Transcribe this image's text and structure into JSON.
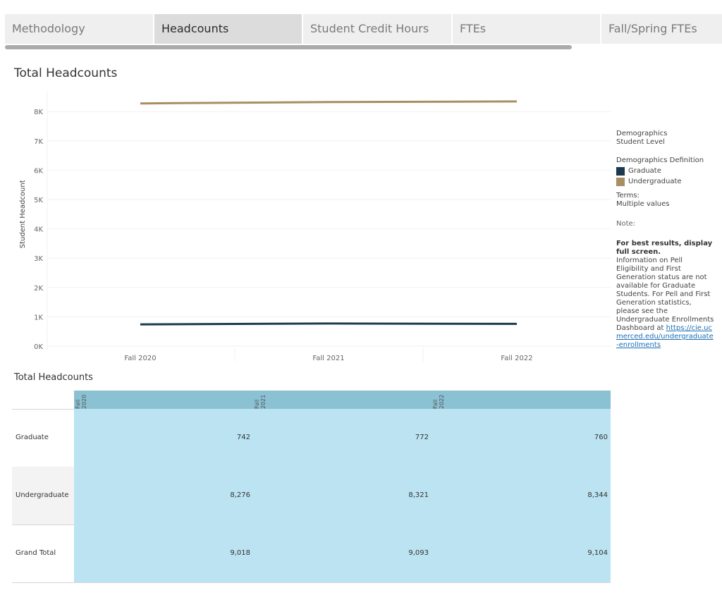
{
  "tabs": [
    {
      "label": "Methodology",
      "active": false
    },
    {
      "label": "Headcounts",
      "active": true
    },
    {
      "label": "Student Credit Hours",
      "active": false
    },
    {
      "label": "FTEs",
      "active": false
    },
    {
      "label": "Fall/Spring FTEs",
      "active": false
    }
  ],
  "chart_title": "Total Headcounts",
  "chart_data": {
    "type": "line",
    "title": "Total Headcounts",
    "xlabel": "",
    "ylabel": "Student Headcount",
    "categories": [
      "Fall 2020",
      "Fall 2021",
      "Fall 2022"
    ],
    "ylim": [
      0,
      8500
    ],
    "yticks": [
      0,
      1000,
      2000,
      3000,
      4000,
      5000,
      6000,
      7000,
      8000
    ],
    "ytick_labels": [
      "0K",
      "1K",
      "2K",
      "3K",
      "4K",
      "5K",
      "6K",
      "7K",
      "8K"
    ],
    "grid": true,
    "legend_position": "right",
    "series": [
      {
        "name": "Graduate",
        "color": "#1c3a4f",
        "values": [
          742,
          772,
          760
        ]
      },
      {
        "name": "Undergraduate",
        "color": "#a88e63",
        "values": [
          8276,
          8321,
          8344
        ]
      }
    ]
  },
  "legend": {
    "demographics_title": "Demographics",
    "demographics_value": "Student Level",
    "definition_title": "Demographics Definition",
    "items": [
      {
        "label": "Graduate",
        "color": "#1c3a4f"
      },
      {
        "label": "Undergraduate",
        "color": "#a88e63"
      }
    ],
    "terms_title": "Terms:",
    "terms_value": "Multiple values",
    "note_label": "Note:",
    "note_bold": "For best results, display full screen.",
    "note_text": "Information on Pell Eligibility and First Generation status are not available for Graduate Students. For Pell and First Generation statistics, please see the Undergraduate Enrollments Dashboard at ",
    "note_link": "https://cie.ucmerced.edu/undergraduate-enrollments"
  },
  "table": {
    "title": "Total Headcounts",
    "columns": [
      "Fall 2020",
      "Fall 2021",
      "Fall 2022"
    ],
    "rows": [
      {
        "label": "Graduate",
        "values": [
          "742",
          "772",
          "760"
        ]
      },
      {
        "label": "Undergraduate",
        "values": [
          "8,276",
          "8,321",
          "8,344"
        ]
      },
      {
        "label": "Grand Total",
        "values": [
          "9,018",
          "9,093",
          "9,104"
        ]
      }
    ]
  }
}
